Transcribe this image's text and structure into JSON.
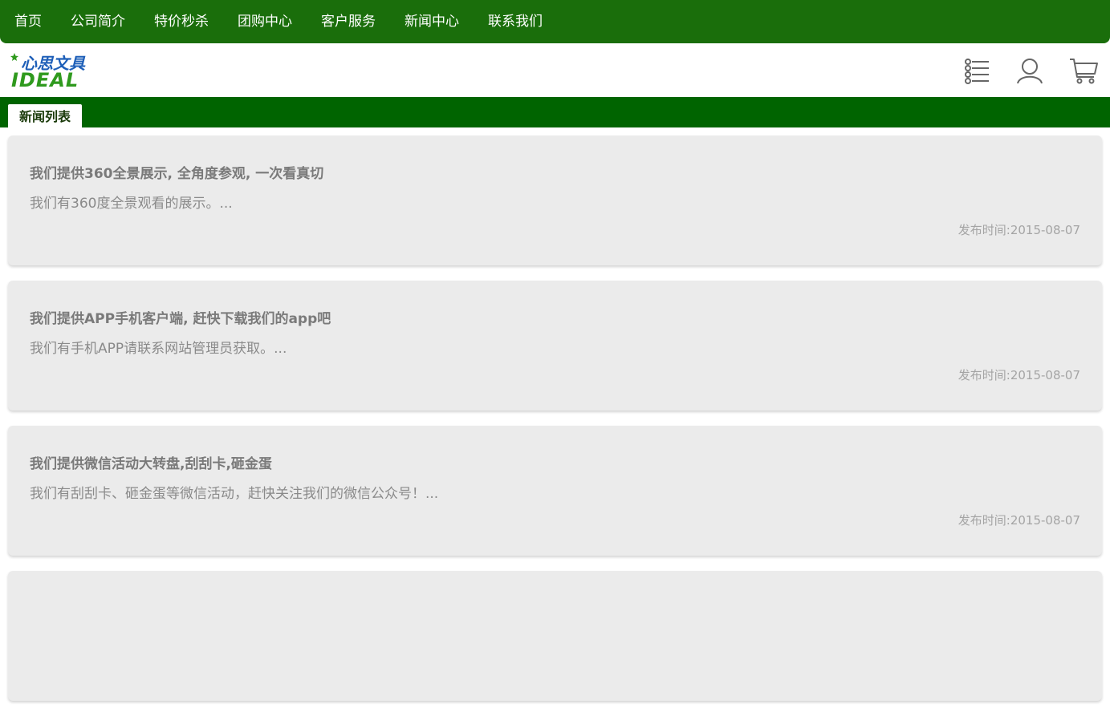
{
  "nav": {
    "items": [
      {
        "label": "首页"
      },
      {
        "label": "公司简介"
      },
      {
        "label": "特价秒杀"
      },
      {
        "label": "团购中心"
      },
      {
        "label": "客户服务"
      },
      {
        "label": "新闻中心"
      },
      {
        "label": "联系我们"
      }
    ]
  },
  "header": {
    "logo_text_cn": "心思文具",
    "logo_text_en": "IDEAL",
    "icons": [
      "menu-list-icon",
      "user-icon",
      "cart-icon"
    ]
  },
  "section": {
    "tab_label": "新闻列表"
  },
  "news": [
    {
      "title": "我们提供360全景展示, 全角度参观, 一次看真切",
      "summary": "我们有360度全景观看的展示。...",
      "date": "发布时间:2015-08-07"
    },
    {
      "title": "我们提供APP手机客户端, 赶快下载我们的app吧",
      "summary": "我们有手机APP请联系网站管理员获取。...",
      "date": "发布时间:2015-08-07"
    },
    {
      "title": "我们提供微信活动大转盘,刮刮卡,砸金蛋",
      "summary": "我们有刮刮卡、砸金蛋等微信活动，赶快关注我们的微信公众号！...",
      "date": "发布时间:2015-08-07"
    },
    {
      "title": "",
      "summary": "",
      "date": ""
    }
  ],
  "colors": {
    "nav_bg": "#1a6e0b",
    "section_bar": "#006400",
    "card_bg": "#ebebeb",
    "logo_blue": "#1e5fb8",
    "logo_green": "#2f9a1e"
  }
}
